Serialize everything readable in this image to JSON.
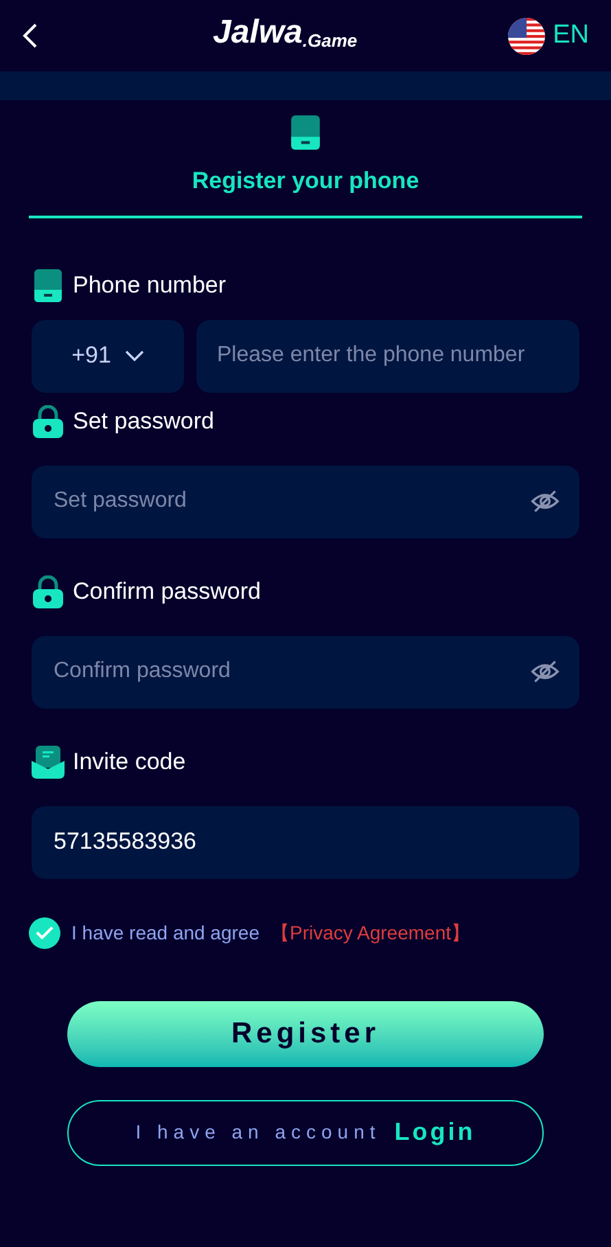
{
  "header": {
    "logo_main": "Jalwa",
    "logo_suffix": ".Game",
    "language": "EN"
  },
  "tab": {
    "title": "Register your phone",
    "selected": true
  },
  "fields": [
    {
      "kind": "phone",
      "label": "Phone number",
      "country_code": "+91",
      "placeholder": "Please enter the phone number"
    },
    {
      "kind": "password",
      "label": "Set password",
      "placeholder": "Set password"
    },
    {
      "kind": "password",
      "label": "Confirm password",
      "placeholder": "Confirm password"
    },
    {
      "kind": "invite",
      "label": "Invite code",
      "value": "57135583936"
    }
  ],
  "agreement": {
    "checked": true,
    "text": "I have read and agree",
    "link": "【Privacy Agreement】"
  },
  "register_button": "Register",
  "login": {
    "text": "I have an account",
    "link": "Login"
  }
}
